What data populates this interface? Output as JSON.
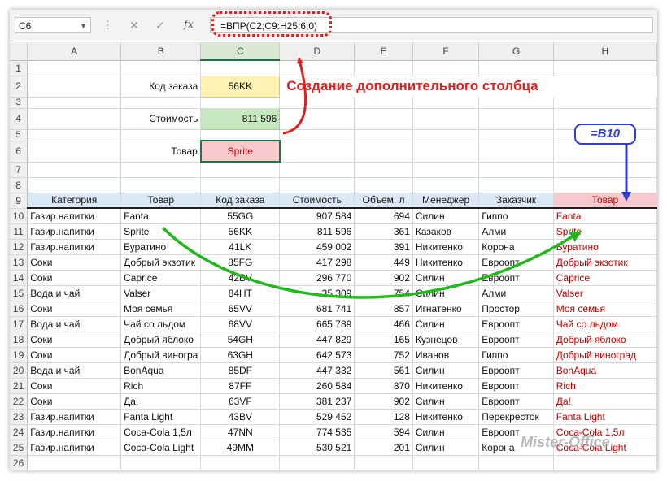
{
  "formula_bar": {
    "name_box": "C6",
    "formula": "=ВПР(C2;C9:H25;6;0)",
    "cancel_glyph": "✕",
    "enter_glyph": "✓",
    "fx_label": "fx"
  },
  "columns": [
    "A",
    "B",
    "C",
    "D",
    "E",
    "F",
    "G",
    "H"
  ],
  "lookup": {
    "rows": [
      "1",
      "2",
      "3",
      "4",
      "5",
      "6",
      "7",
      "8"
    ],
    "order_label": "Код заказа",
    "order_value": "56KK",
    "cost_label": "Стоимость",
    "cost_value": "811 596",
    "product_label": "Товар",
    "product_value": "Sprite"
  },
  "annotation": {
    "title": "Создание дополнительного столбца",
    "ref_badge": "=B10"
  },
  "table": {
    "header_row": "9",
    "headers": [
      "Категория",
      "Товар",
      "Код заказа",
      "Стоимость",
      "Объем, л",
      "Менеджер",
      "Заказчик",
      "Товар"
    ],
    "rows": [
      {
        "n": "10",
        "cat": "Газир.напитки",
        "prod": "Fanta",
        "code": "55GG",
        "cost": "907 584",
        "vol": "694",
        "mgr": "Силин",
        "cust": "Гиппо",
        "copy": "Fanta"
      },
      {
        "n": "11",
        "cat": "Газир.напитки",
        "prod": "Sprite",
        "code": "56KK",
        "cost": "811 596",
        "vol": "361",
        "mgr": "Казаков",
        "cust": "Алми",
        "copy": "Sprite"
      },
      {
        "n": "12",
        "cat": "Газир.напитки",
        "prod": "Буратино",
        "code": "41LK",
        "cost": "459 002",
        "vol": "391",
        "mgr": "Никитенко",
        "cust": "Корона",
        "copy": "Буратино"
      },
      {
        "n": "13",
        "cat": "Соки",
        "prod": "Добрый экзотик",
        "code": "85FG",
        "cost": "417 298",
        "vol": "449",
        "mgr": "Никитенко",
        "cust": "Евроопт",
        "copy": "Добрый экзотик"
      },
      {
        "n": "14",
        "cat": "Соки",
        "prod": "Caprice",
        "code": "42BV",
        "cost": "296 770",
        "vol": "902",
        "mgr": "Силин",
        "cust": "Евроопт",
        "copy": "Caprice"
      },
      {
        "n": "15",
        "cat": "Вода и чай",
        "prod": "Valser",
        "code": "84HT",
        "cost": "35 309",
        "vol": "754",
        "mgr": "Силин",
        "cust": "Алми",
        "copy": "Valser"
      },
      {
        "n": "16",
        "cat": "Соки",
        "prod": "Моя семья",
        "code": "65VV",
        "cost": "681 741",
        "vol": "857",
        "mgr": "Игнатенко",
        "cust": "Простор",
        "copy": "Моя семья"
      },
      {
        "n": "17",
        "cat": "Вода и чай",
        "prod": "Чай со льдом",
        "code": "68VV",
        "cost": "665 789",
        "vol": "466",
        "mgr": "Силин",
        "cust": "Евроопт",
        "copy": "Чай со льдом"
      },
      {
        "n": "18",
        "cat": "Соки",
        "prod": "Добрый яблоко",
        "code": "54GH",
        "cost": "447 829",
        "vol": "165",
        "mgr": "Кузнецов",
        "cust": "Евроопт",
        "copy": "Добрый яблоко"
      },
      {
        "n": "19",
        "cat": "Соки",
        "prod": "Добрый виногра",
        "code": "63GH",
        "cost": "642 573",
        "vol": "752",
        "mgr": "Иванов",
        "cust": "Гиппо",
        "copy": "Добрый виноград"
      },
      {
        "n": "20",
        "cat": "Вода и чай",
        "prod": "BonAqua",
        "code": "85DF",
        "cost": "447 332",
        "vol": "561",
        "mgr": "Силин",
        "cust": "Евроопт",
        "copy": "BonAqua"
      },
      {
        "n": "21",
        "cat": "Соки",
        "prod": "Rich",
        "code": "87FF",
        "cost": "260 584",
        "vol": "870",
        "mgr": "Никитенко",
        "cust": "Евроопт",
        "copy": "Rich"
      },
      {
        "n": "22",
        "cat": "Соки",
        "prod": "Да!",
        "code": "63VF",
        "cost": "381 237",
        "vol": "902",
        "mgr": "Силин",
        "cust": "Евроопт",
        "copy": "Да!"
      },
      {
        "n": "23",
        "cat": "Газир.напитки",
        "prod": "Fanta Light",
        "code": "43BV",
        "cost": "529 452",
        "vol": "128",
        "mgr": "Никитенко",
        "cust": "Перекресток",
        "copy": "Fanta Light"
      },
      {
        "n": "24",
        "cat": "Газир.напитки",
        "prod": "Coca-Cola 1,5л",
        "code": "47NN",
        "cost": "774 535",
        "vol": "594",
        "mgr": "Силин",
        "cust": "Евроопт",
        "copy": "Coca-Cola 1,5л"
      },
      {
        "n": "25",
        "cat": "Газир.напитки",
        "prod": "Coca-Cola Light",
        "code": "49MM",
        "cost": "530 521",
        "vol": "201",
        "mgr": "Силин",
        "cust": "Корона",
        "copy": "Coca-Cola Light"
      }
    ],
    "trailing_row": "26"
  },
  "watermark": "Mister-Office",
  "colors": {
    "annotation_red": "#e02020",
    "arrow_green": "#22b81c",
    "arrow_blue": "#2b3fd8",
    "excel_green": "#217346",
    "copy_col_text": "#c00000"
  }
}
